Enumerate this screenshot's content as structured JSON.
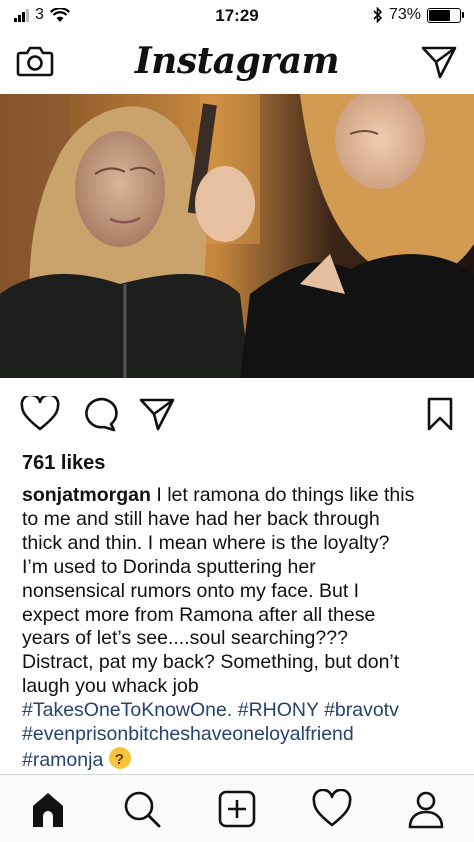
{
  "status_bar": {
    "carrier": "3",
    "time": "17:29",
    "battery_percent": "73%",
    "battery_level": 0.73
  },
  "nav": {
    "brand": "Instagram"
  },
  "post": {
    "likes": "761 likes",
    "username": "sonjatmorgan",
    "caption_lines": [
      " I let ramona do things like this",
      "to me and still have had her back through",
      "thick and thin. I mean where is the loyalty?",
      "I’m used to Dorinda sputtering her",
      "nonsensical rumors onto my face. But I",
      "expect more from Ramona after all these",
      "years of let’s see....soul searching???",
      "Distract, pat my back? Something, but don’t",
      "laugh you whack job"
    ],
    "hashtags_line1": [
      "#TakesOneToKnowOne.",
      "#RHONY",
      "#bravotv"
    ],
    "hashtags_line2": "#evenprisonbitcheshaveoneloyalfriend",
    "hashtags_line3": "#ramonja",
    "emoji": "thinking-face"
  },
  "icons": {
    "camera": "camera-icon",
    "direct": "paper-plane-icon",
    "like": "heart-icon",
    "comment": "comment-icon",
    "share": "paper-plane-icon",
    "save": "bookmark-icon",
    "home": "home-icon",
    "search": "search-icon",
    "add": "plus-square-icon",
    "activity": "heart-icon",
    "profile": "profile-icon"
  }
}
